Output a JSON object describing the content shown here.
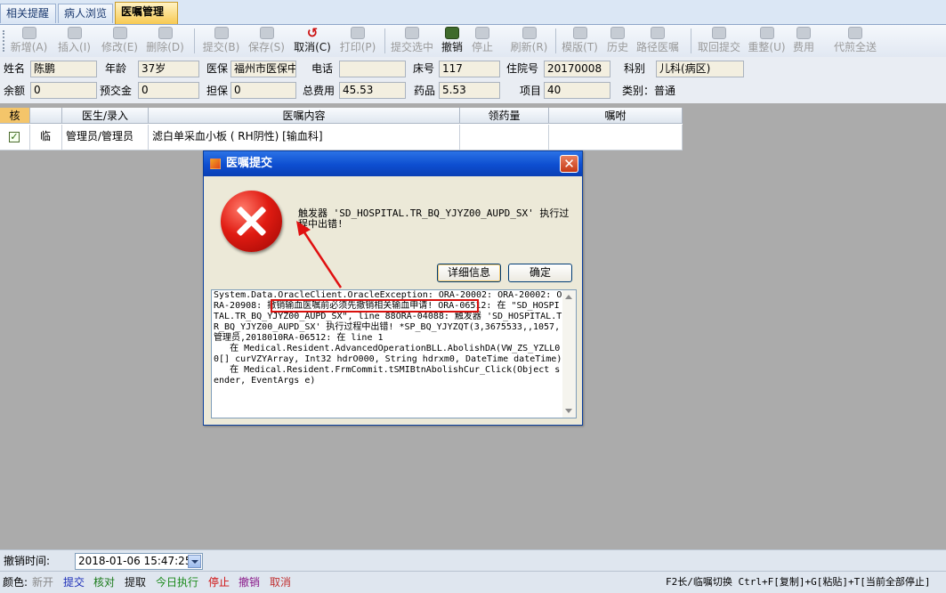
{
  "tabs": [
    {
      "label": "相关提醒",
      "active": false
    },
    {
      "label": "病人浏览",
      "active": false
    },
    {
      "label": "医嘱管理",
      "active": true
    }
  ],
  "toolbar": {
    "items": [
      {
        "label": "新增(A)",
        "icon": "add-icon",
        "enabled": false
      },
      {
        "label": "插入(I)",
        "icon": "insert-icon",
        "enabled": false
      },
      {
        "label": "修改(E)",
        "icon": "edit-icon",
        "enabled": false
      },
      {
        "label": "删除(D)",
        "icon": "delete-icon",
        "enabled": false
      },
      {
        "label": "提交(B)",
        "icon": "submit-icon",
        "enabled": false
      },
      {
        "label": "保存(S)",
        "icon": "save-icon",
        "enabled": false
      },
      {
        "label": "取消(C)",
        "icon": "cancel-icon",
        "enabled": true
      },
      {
        "label": "打印(P)",
        "icon": "print-icon",
        "enabled": false
      },
      {
        "label": "提交选中",
        "icon": "submit-selected-icon",
        "enabled": false
      },
      {
        "label": "撤销",
        "icon": "revoke-icon",
        "enabled": true
      },
      {
        "label": "停止",
        "icon": "stop-icon",
        "enabled": false
      },
      {
        "label": "刷新(R)",
        "icon": "refresh-icon",
        "enabled": false
      },
      {
        "label": "模版(T)",
        "icon": "template-icon",
        "enabled": false
      },
      {
        "label": "历史",
        "icon": "history-icon",
        "enabled": false
      },
      {
        "label": "路径医嘱",
        "icon": "pathway-icon",
        "enabled": false
      },
      {
        "label": "取回提交",
        "icon": "retrieve-icon",
        "enabled": false
      },
      {
        "label": "重整(U)",
        "icon": "reorganize-icon",
        "enabled": false
      },
      {
        "label": "费用",
        "icon": "fee-icon",
        "enabled": false
      },
      {
        "label": "代煎全送",
        "icon": "decoct-icon",
        "enabled": false
      }
    ]
  },
  "patient": {
    "name_label": "姓名",
    "name": "陈鹏",
    "age_label": "年龄",
    "age": "37岁",
    "insurance_label": "医保",
    "insurance": "福州市医保中",
    "phone_label": "电话",
    "phone": "",
    "bed_label": "床号",
    "bed": "117",
    "admission_label": "住院号",
    "admission": "20170008",
    "dept_label": "科别",
    "dept": "儿科(病区)",
    "balance_label": "余额",
    "balance": "0",
    "deposit_label": "预交金",
    "deposit": "0",
    "guarantee_label": "担保",
    "guarantee": "0",
    "total_label": "总费用",
    "total": "45.53",
    "drug_label": "药品",
    "drug": "5.53",
    "item_label": "项目",
    "item": "40",
    "category_text": "类别：普通"
  },
  "grid": {
    "headers": [
      "核",
      "",
      "医生/录入",
      "医嘱内容",
      "领药量",
      "嘱咐"
    ],
    "rows": [
      {
        "checked": true,
        "type": "临",
        "doctor": "管理员/管理员",
        "content": "滤白单采血小板 ( RH阴性)     [输血科]",
        "quantity": "",
        "instruction": ""
      }
    ]
  },
  "dialog": {
    "title": "医嘱提交",
    "close_glyph": "✕",
    "message": "触发器 'SD_HOSPITAL.TR_BQ_YJYZ00_AUPD_SX' 执行过程中出错!",
    "detail_button": "详细信息",
    "ok_button": "确定",
    "detail_text": "System.Data.OracleClient.OracleException: ORA-20002: ORA-20002: ORA-20908: 撤销输血医嘱前必须先撤销相关输血申请! ORA-06512: 在 \"SD_HOSPITAL.TR_BQ_YJYZ00_AUPD_SX\", line 88ORA-04088: 触发器 'SD_HOSPITAL.TR_BQ_YJYZ00_AUPD_SX' 执行过程中出错! *SP_BQ_YJYZQT(3,3675533,,1057,管理员,2018010RA-06512: 在 line 1\n   在 Medical.Resident.AdvancedOperationBLL.AbolishDA(VW_ZS_YZLL00[] curVZYArray, Int32 hdrO000, String hdrxm0, DateTime dateTime)\n   在 Medical.Resident.FrmCommit.tSMIBtnAbolishCur_Click(Object sender, EventArgs e)"
  },
  "cancel_bar": {
    "label": "撤销时间:",
    "value": "2018-01-06 15:47:25"
  },
  "status": {
    "color_label": "颜色:",
    "legend": [
      {
        "label": "新开",
        "color": "#8a8a8a"
      },
      {
        "label": "提交",
        "color": "#1d2fb8"
      },
      {
        "label": "核对",
        "color": "#1a7a1a"
      },
      {
        "label": "提取",
        "color": "#111111"
      },
      {
        "label": "今日执行",
        "color": "#1a8a1a"
      },
      {
        "label": "停止",
        "color": "#d01010"
      },
      {
        "label": "撤销",
        "color": "#8a1a8a"
      },
      {
        "label": "取消",
        "color": "#c03030"
      }
    ],
    "shortcuts": "F2长/临嘱切换 Ctrl+F[复制]+G[粘贴]+T[当前全部停止]"
  }
}
